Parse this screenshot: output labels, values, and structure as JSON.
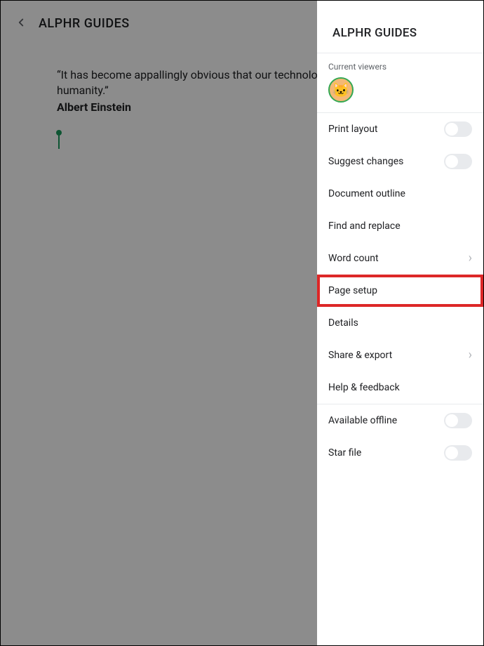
{
  "document": {
    "title": "ALPHR GUIDES",
    "quote": "“It has become appallingly obvious that our technology has exceeded our humanity.”",
    "author": "Albert Einstein"
  },
  "panel": {
    "title": "ALPHR GUIDES",
    "viewers_label": "Current viewers",
    "avatar_glyph": "🐱",
    "items": {
      "print_layout": "Print layout",
      "suggest_changes": "Suggest changes",
      "document_outline": "Document outline",
      "find_replace": "Find and replace",
      "word_count": "Word count",
      "page_setup": "Page setup",
      "details": "Details",
      "share_export": "Share & export",
      "help_feedback": "Help & feedback",
      "available_offline": "Available offline",
      "star_file": "Star file"
    }
  }
}
